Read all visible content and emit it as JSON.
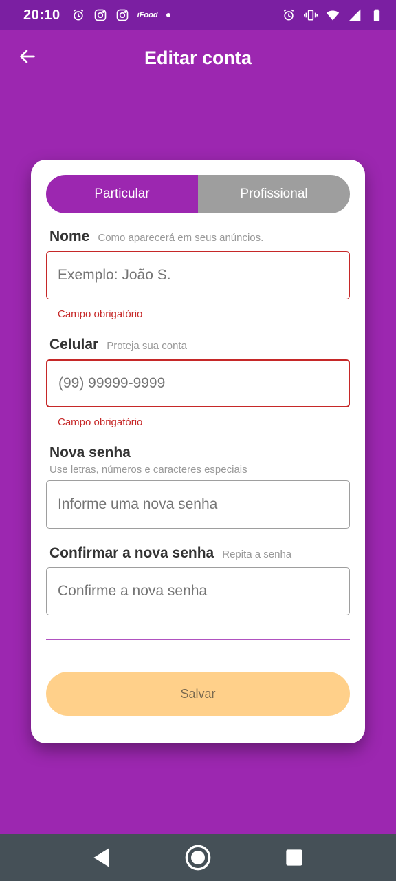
{
  "status_bar": {
    "time": "20:10",
    "left_icons": [
      "alarm-icon",
      "instagram-icon",
      "instagram-icon",
      "ifood-icon",
      "notification-dot"
    ],
    "ifood_text": "iFood",
    "right_icons": [
      "alarm-icon",
      "vibrate-icon",
      "wifi-icon",
      "signal-icon",
      "battery-icon"
    ]
  },
  "app_bar": {
    "title": "Editar conta",
    "back_icon": "arrow-back-icon"
  },
  "account_type": {
    "options": [
      "Particular",
      "Profissional"
    ],
    "selected": "Particular",
    "active_color": "#9c27b0",
    "inactive_color": "#9e9e9e"
  },
  "form": {
    "name": {
      "label": "Nome",
      "hint": "Como aparecerá em seus anúncios.",
      "placeholder": "Exemplo: João S.",
      "error": "Campo obrigatório"
    },
    "phone": {
      "label": "Celular",
      "hint": "Proteja sua conta",
      "placeholder": "(99) 99999-9999",
      "error": "Campo obrigatório"
    },
    "new_password": {
      "label": "Nova senha",
      "hint": "Use letras, números e caracteres especiais",
      "placeholder": "Informe uma nova senha"
    },
    "confirm_password": {
      "label": "Confirmar a nova senha",
      "hint": "Repita a senha",
      "placeholder": "Confirme a nova senha"
    }
  },
  "save_button": {
    "label": "Salvar",
    "color": "#ffd08a"
  },
  "colors": {
    "primary": "#9c27b0",
    "status_bar": "#7b1fa2",
    "error": "#c62828",
    "nav_bar": "#455057"
  },
  "nav_bar": {
    "buttons": [
      "back-triangle-icon",
      "home-circle-icon",
      "recents-square-icon"
    ]
  }
}
